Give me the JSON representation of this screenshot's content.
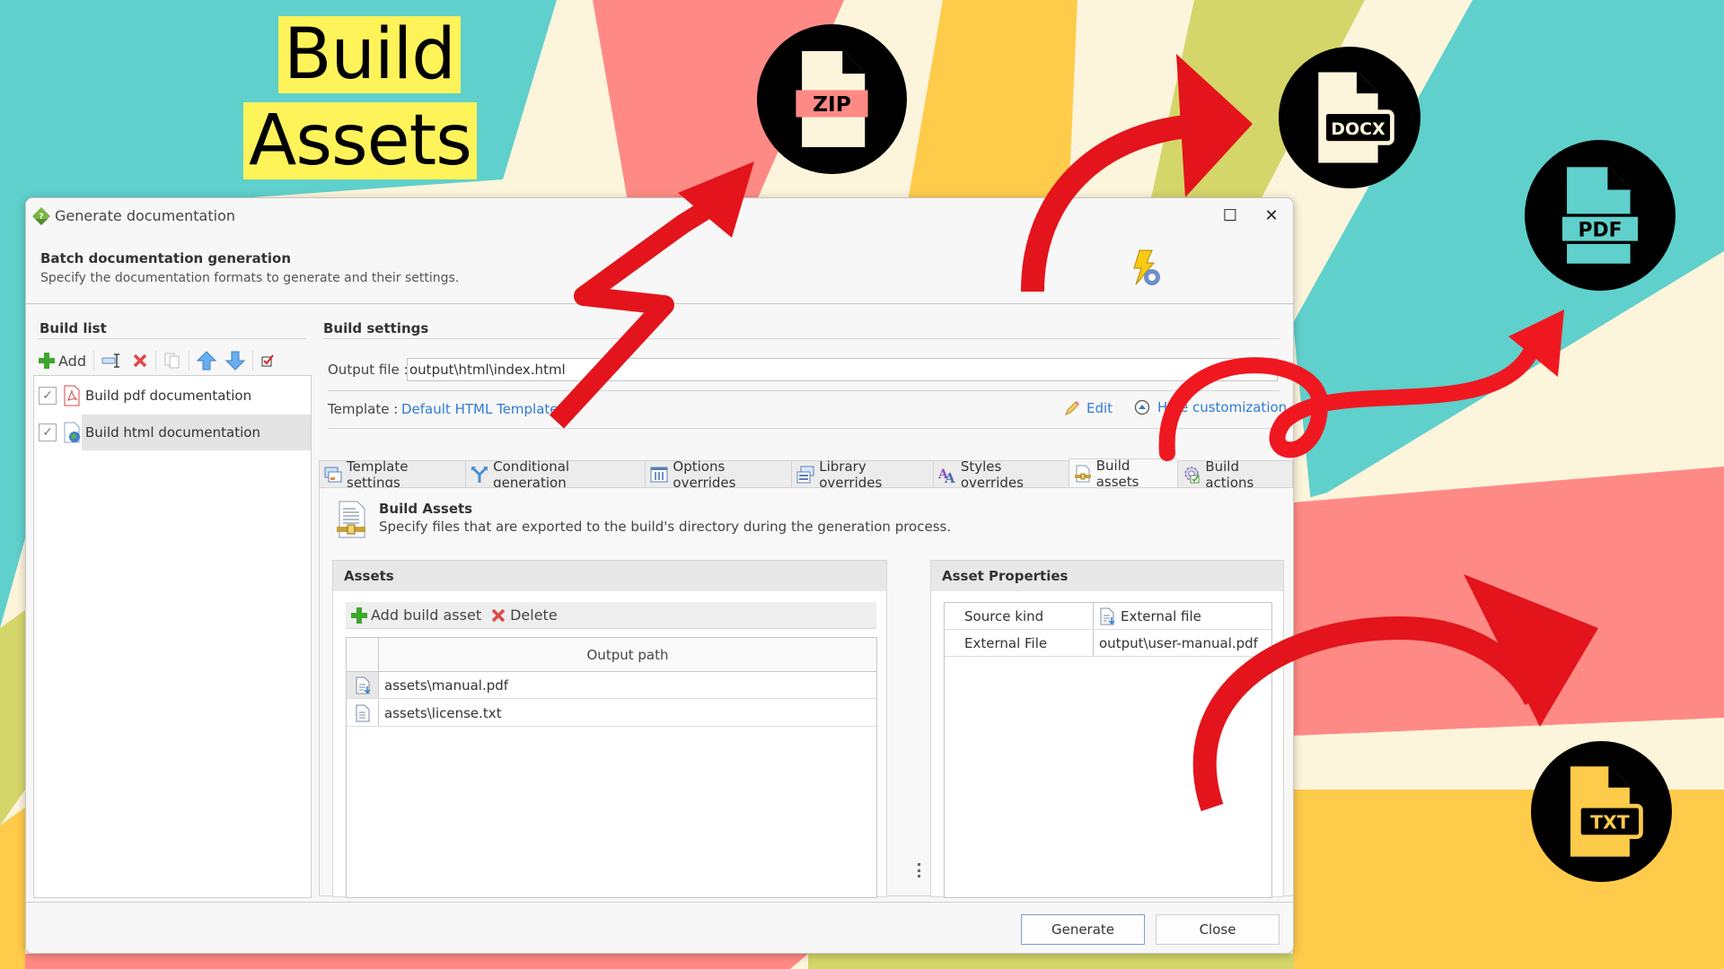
{
  "banner": {
    "title_line1": "Build",
    "title_line2": "Assets",
    "badges": [
      {
        "label": "ZIP",
        "icon": "zip-file-icon"
      },
      {
        "label": "DOCX",
        "icon": "docx-file-icon"
      },
      {
        "label": "PDF",
        "icon": "pdf-file-icon"
      },
      {
        "label": "TXT",
        "icon": "txt-file-icon"
      }
    ]
  },
  "colors": {
    "teal": "#5fd0cb",
    "pink": "#ff8a85",
    "yellow": "#fecb4a",
    "lime": "#d4d66a",
    "cream": "#fdf4dc",
    "arrow_red": "#e3141b",
    "link_blue": "#2f7bd3",
    "chip_yellow": "#fff35a"
  },
  "window": {
    "title": "Generate documentation",
    "maximize_glyph": "☐",
    "close_glyph": "✕",
    "header_title": "Batch documentation generation",
    "header_subtitle": "Specify the documentation formats to generate and their settings."
  },
  "build_list": {
    "label": "Build list",
    "toolbar": {
      "add_label": "Add"
    },
    "items": [
      {
        "label": "Build pdf documentation",
        "checked": true,
        "selected": false
      },
      {
        "label": "Build html documentation",
        "checked": true,
        "selected": true
      }
    ]
  },
  "build_settings": {
    "label": "Build settings",
    "output_file_label": "Output file :",
    "output_file_value": "output\\html\\index.html",
    "browse_label": "...",
    "template_label": "Template :",
    "template_link": "Default HTML Template",
    "edit_label": "Edit",
    "hide_customization_label": "Hide customization"
  },
  "tabs": [
    {
      "label": "Template settings",
      "active": false
    },
    {
      "label": "Conditional generation",
      "active": false
    },
    {
      "label": "Options overrides",
      "active": false
    },
    {
      "label": "Library overrides",
      "active": false
    },
    {
      "label": "Styles overrides",
      "active": false
    },
    {
      "label": "Build assets",
      "active": true
    },
    {
      "label": "Build actions",
      "active": false
    }
  ],
  "build_assets": {
    "title": "Build Assets",
    "description": "Specify files that are exported to the build's directory during the generation process.",
    "assets_group_label": "Assets",
    "add_label": "Add build asset",
    "delete_label": "Delete",
    "column_header": "Output path",
    "rows": [
      {
        "path": "assets\\manual.pdf",
        "icon": "external-file-icon",
        "current": true
      },
      {
        "path": "assets\\license.txt",
        "icon": "text-file-icon",
        "current": false
      }
    ],
    "properties_group_label": "Asset Properties",
    "properties": [
      {
        "key": "Source kind",
        "value": "External file"
      },
      {
        "key": "External File",
        "value": "output\\user-manual.pdf"
      }
    ]
  },
  "footer": {
    "generate_label": "Generate",
    "close_label": "Close"
  }
}
